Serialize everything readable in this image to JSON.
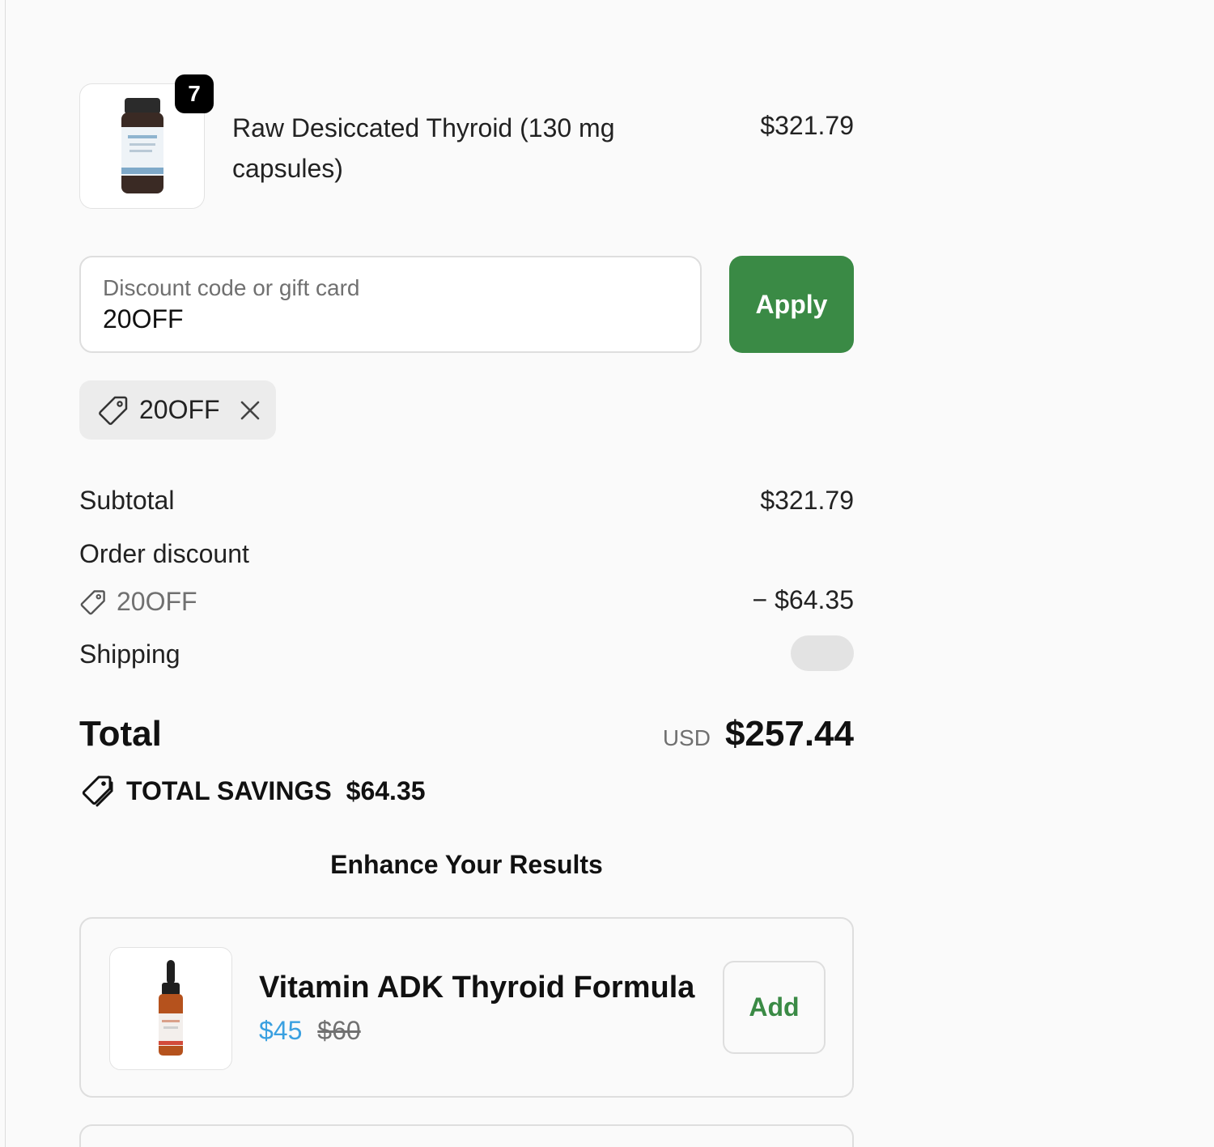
{
  "line_item": {
    "quantity": "7",
    "name": "Raw Desiccated Thyroid (130 mg capsules)",
    "price": "$321.79",
    "image_icon": "supplement-bottle-icon"
  },
  "discount": {
    "placeholder": "Discount code or gift card",
    "value": "20OFF",
    "apply_label": "Apply",
    "applied_code": "20OFF"
  },
  "summary": {
    "subtotal_label": "Subtotal",
    "subtotal_value": "$321.79",
    "order_discount_label": "Order discount",
    "discount_code": "20OFF",
    "discount_value": "− $64.35",
    "shipping_label": "Shipping"
  },
  "total": {
    "label": "Total",
    "currency": "USD",
    "amount": "$257.44"
  },
  "savings": {
    "label": "TOTAL SAVINGS",
    "amount": "$64.35"
  },
  "upsell": {
    "title": "Enhance Your Results",
    "items": [
      {
        "name": "Vitamin ADK Thyroid Formula",
        "price_now": "$45",
        "price_was": "$60",
        "add_label": "Add",
        "image_icon": "dropper-bottle-icon"
      }
    ]
  },
  "colors": {
    "accent_green": "#3a8a45",
    "sale_blue": "#3aa0e0",
    "badge_black": "#000000"
  }
}
